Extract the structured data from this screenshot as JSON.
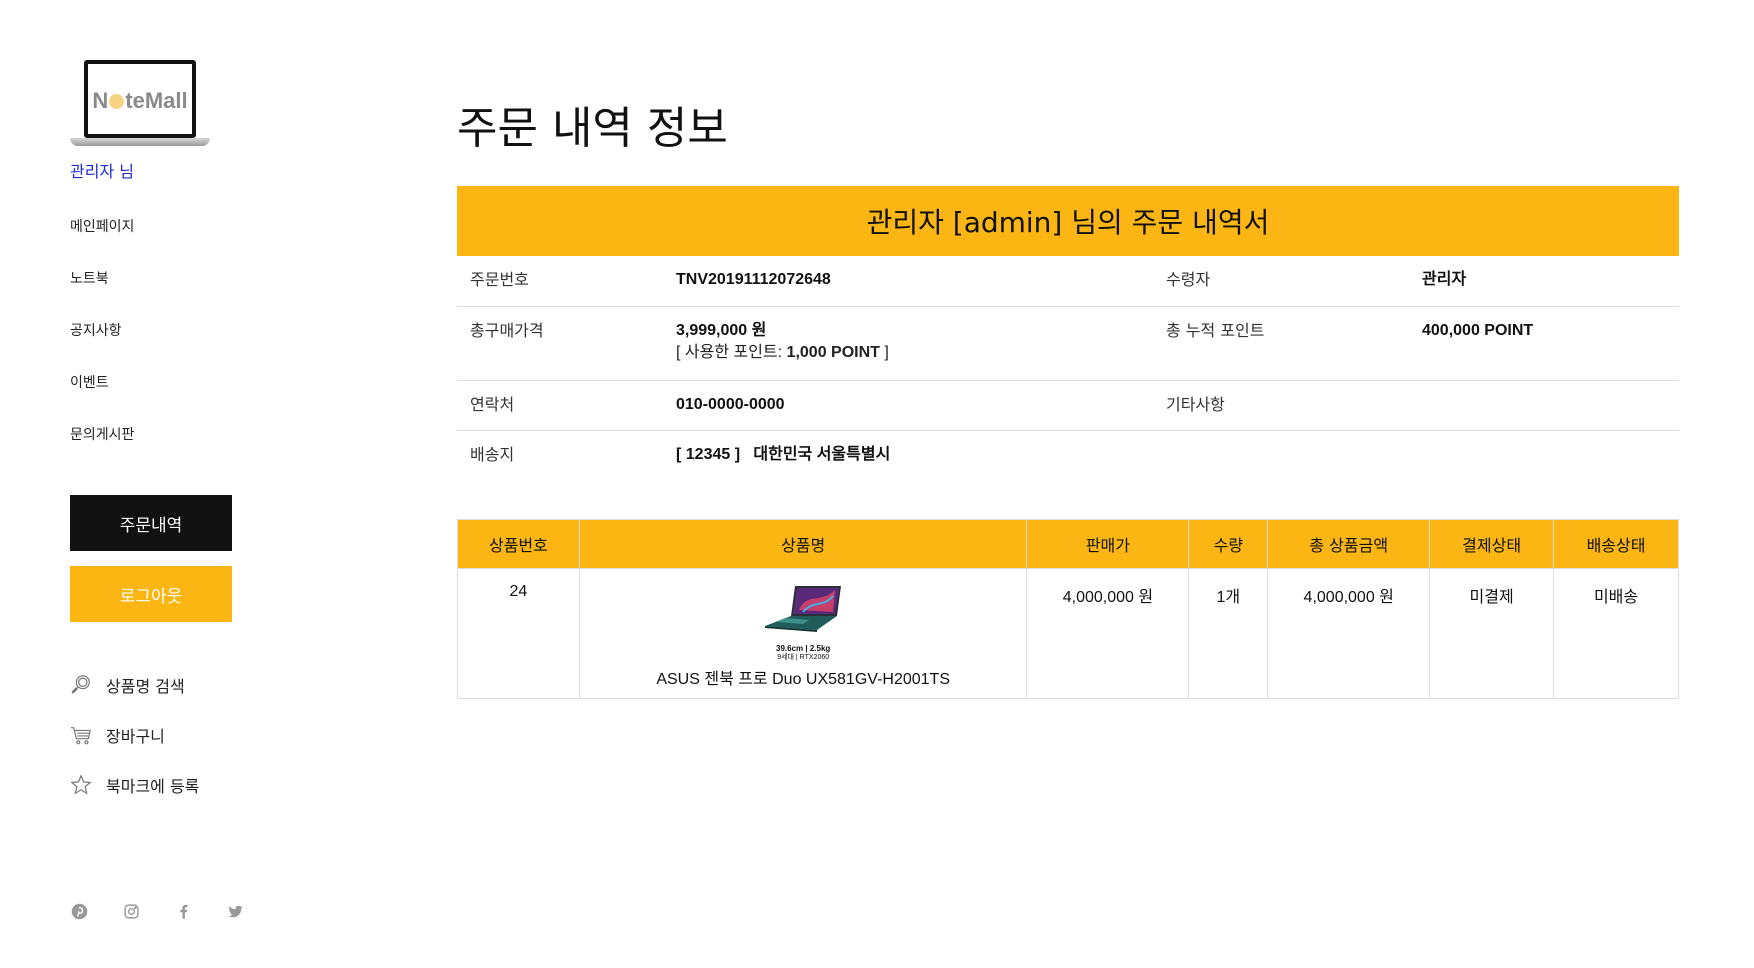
{
  "sidebar": {
    "logo_text_pre": "N",
    "logo_text_post": "teMall",
    "user_name": "관리자 님",
    "menu": [
      "메인페이지",
      "노트북",
      "공지사항",
      "이벤트",
      "문의게시판"
    ],
    "orders_button": "주문내역",
    "logout_button": "로그아웃",
    "tools": [
      {
        "label": "상품명 검색",
        "icon": "search-icon"
      },
      {
        "label": "장바구니",
        "icon": "cart-icon"
      },
      {
        "label": "북마크에 등록",
        "icon": "star-icon"
      }
    ],
    "social_icons": [
      "pinterest-icon",
      "instagram-icon",
      "facebook-icon",
      "twitter-icon"
    ]
  },
  "main": {
    "title": "주문 내역 정보",
    "order_header": "관리자 [admin] 님의 주문 내역서",
    "info": {
      "order_no_label": "주문번호",
      "order_no": "TNV20191112072648",
      "recipient_label": "수령자",
      "recipient": "관리자",
      "total_price_label": "총구매가격",
      "total_price": "3,999,000 원",
      "used_point_prefix": "[ 사용한 포인트: ",
      "used_point": "1,000 POINT",
      "used_point_suffix": " ]",
      "points_label": "총 누적 포인트",
      "points": "400,000 POINT",
      "contact_label": "연락처",
      "contact": "010-0000-0000",
      "etc_label": "기타사항",
      "etc": "",
      "address_label": "배송지",
      "address": "[ 12345 ]   대한민국 서울특별시"
    },
    "table": {
      "headers": [
        "상품번호",
        "상품명",
        "판매가",
        "수량",
        "총 상품금액",
        "결제상태",
        "배송상태"
      ],
      "rows": [
        {
          "product_no": "24",
          "product_name": "ASUS 젠북 프로 Duo UX581GV-H2001TS",
          "image_spec_1": "39.6cm",
          "image_spec_2": "2.5kg",
          "image_spec_3": "9세대 | RTX2060",
          "price": "4,000,000 원",
          "qty": "1개",
          "total": "4,000,000 원",
          "payment_status": "미결제",
          "delivery_status": "미배송"
        }
      ]
    }
  },
  "colors": {
    "accent": "#fbb614",
    "dark_button": "#111111",
    "link_blue": "#1d2bd8"
  }
}
